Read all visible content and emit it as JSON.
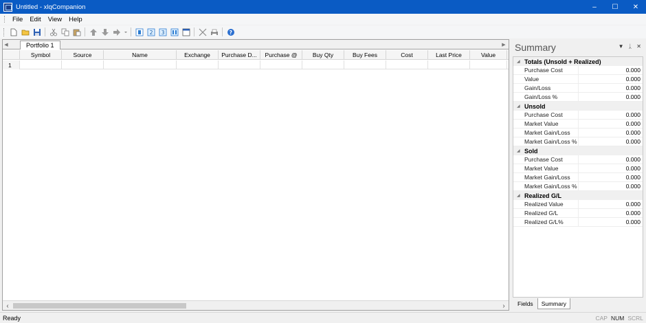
{
  "window": {
    "title": "Untitled - xlqCompanion",
    "controls": {
      "minimize": "–",
      "maximize": "☐",
      "close": "✕"
    }
  },
  "menu": {
    "items": [
      "File",
      "Edit",
      "View",
      "Help"
    ]
  },
  "toolbar": {
    "icons": [
      "new-icon",
      "open-icon",
      "save-icon",
      "cut-icon",
      "copy-icon",
      "paste-icon",
      "move-up-icon",
      "move-down-icon",
      "move-right-icon",
      "column-1-icon",
      "column-2-icon",
      "column-3-icon",
      "column-4-icon",
      "window-icon",
      "split-icon",
      "print-icon",
      "help-icon"
    ]
  },
  "tabs": {
    "active": "Portfolio 1"
  },
  "grid": {
    "columns": [
      "Symbol",
      "Source",
      "Name",
      "Exchange",
      "Purchase D...",
      "Purchase @",
      "Buy Qty",
      "Buy Fees",
      "Cost",
      "Last Price",
      "Value"
    ],
    "rows": [
      {
        "num": "1"
      }
    ]
  },
  "summary": {
    "title": "Summary",
    "sections": [
      {
        "name": "Totals (Unsold + Realized)",
        "rows": [
          {
            "label": "Purchase Cost",
            "value": "0.000"
          },
          {
            "label": "Value",
            "value": "0.000"
          },
          {
            "label": "Gain/Loss",
            "value": "0.000"
          },
          {
            "label": "Gain/Loss %",
            "value": "0.000"
          }
        ]
      },
      {
        "name": "Unsold",
        "rows": [
          {
            "label": "Purchase Cost",
            "value": "0.000"
          },
          {
            "label": "Market Value",
            "value": "0.000"
          },
          {
            "label": "Market Gain/Loss",
            "value": "0.000"
          },
          {
            "label": "Market Gain/Loss %",
            "value": "0.000"
          }
        ]
      },
      {
        "name": "Sold",
        "rows": [
          {
            "label": "Purchase Cost",
            "value": "0.000"
          },
          {
            "label": "Market Value",
            "value": "0.000"
          },
          {
            "label": "Market Gain/Loss",
            "value": "0.000"
          },
          {
            "label": "Market Gain/Loss %",
            "value": "0.000"
          }
        ]
      },
      {
        "name": "Realized G/L",
        "rows": [
          {
            "label": "Realized Value",
            "value": "0.000"
          },
          {
            "label": "Realized G/L",
            "value": "0.000"
          },
          {
            "label": "Realized G/L%",
            "value": "0.000"
          }
        ]
      }
    ],
    "tabs": [
      "Fields",
      "Summary"
    ]
  },
  "status": {
    "text": "Ready",
    "indicators": [
      {
        "label": "CAP",
        "active": false
      },
      {
        "label": "NUM",
        "active": true
      },
      {
        "label": "SCRL",
        "active": false
      }
    ]
  },
  "colors": {
    "titlebar": "#0a5bc4",
    "panel": "#f0f0f0"
  }
}
